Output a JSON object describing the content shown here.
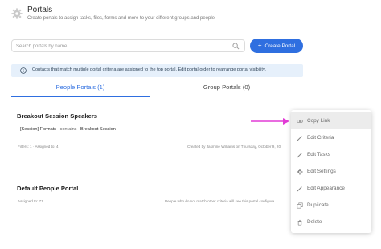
{
  "header": {
    "title": "Portals",
    "subtitle": "Create portals to assign tasks, files, forms and more to your different groups and people",
    "icon": "gear-icon"
  },
  "search": {
    "placeholder": "Search portals by name...",
    "icon": "search-icon"
  },
  "create_button": {
    "label": "Create Portal",
    "icon": "plus-icon"
  },
  "info": {
    "text": "Contacts that match multiple portal criteria are assigned to the top portal. Edit portal order to rearrange portal visibility.",
    "icon": "info-icon"
  },
  "tabs": [
    {
      "label": "People Portals (1)",
      "active": true
    },
    {
      "label": "Group Portals (0)",
      "active": false
    }
  ],
  "portals": [
    {
      "name": "Breakout Session Speakers",
      "criteria": {
        "field": "[Session] Formats",
        "operator": "contains",
        "value": "Breakout Session"
      },
      "meta_left": "Filters: 1 · Assigned to: 4",
      "meta_right": "Created by Jasmine Williams on Thursday, October 9, 20"
    },
    {
      "name": "Default People Portal",
      "meta_left": "Assigned to: 71",
      "meta_right": "People who do not match other criteria will see this portal configura"
    }
  ],
  "menu": {
    "items": [
      {
        "label": "Copy Link",
        "icon": "link-icon",
        "highlighted": true
      },
      {
        "label": "Edit Criteria",
        "icon": "pencil-icon"
      },
      {
        "label": "Edit Tasks",
        "icon": "pencil-icon"
      },
      {
        "label": "Edit Settings",
        "icon": "gear-icon"
      },
      {
        "label": "Edit Appearance",
        "icon": "pencil-icon"
      },
      {
        "label": "Duplicate",
        "icon": "duplicate-icon"
      },
      {
        "label": "Delete",
        "icon": "trash-icon"
      }
    ]
  },
  "colors": {
    "accent": "#2f6fe0",
    "info_bg": "#e6f0fb",
    "annotation_arrow": "#e23bd6"
  }
}
